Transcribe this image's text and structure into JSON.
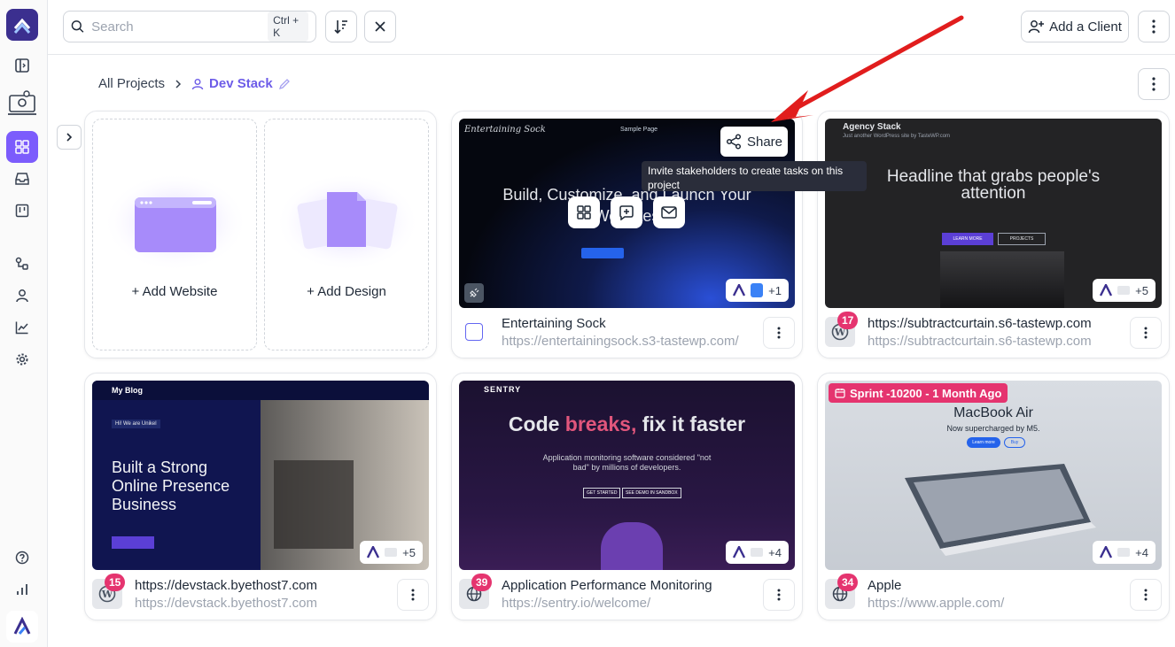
{
  "search": {
    "placeholder": "Search",
    "shortcut": "Ctrl + K"
  },
  "header": {
    "add_client_label": "Add a Client"
  },
  "breadcrumb": {
    "root": "All Projects",
    "current": "Dev Stack"
  },
  "add_tiles": {
    "website": "Add Website",
    "design": "Add Design"
  },
  "share": {
    "label": "Share",
    "tooltip": "Invite stakeholders to create tasks on this project"
  },
  "projects": [
    {
      "title": "Entertaining Sock",
      "url": "https://entertainingsock.s3-tastewp.com/",
      "extra": "+1",
      "thumb_text": "Build, Customize, and Launch Your Websites",
      "brand": "Entertaining Sock",
      "nav": "Sample Page"
    },
    {
      "title": "https://subtractcurtain.s6-tastewp.com",
      "url": "https://subtractcurtain.s6-tastewp.com",
      "badge": "17",
      "extra": "+5",
      "thumb_text": "Headline that grabs people's attention",
      "brand": "Agency Stack",
      "brand_sub": "Just another WordPress site by TasteWP.com",
      "cta1": "LEARN MORE",
      "cta2": "PROJECTS"
    },
    {
      "title": "https://devstack.byethost7.com",
      "url": "https://devstack.byethost7.com",
      "badge": "15",
      "extra": "+5",
      "thumb_text": "Built a Strong Online Presence Business",
      "brand": "My Blog",
      "hero_tag": "Hi! We are Unikel"
    },
    {
      "title": "Application Performance Monitoring",
      "url": "https://sentry.io/welcome/",
      "badge": "39",
      "extra": "+4",
      "thumb_text_1": "Code ",
      "thumb_text_2": "breaks,",
      "thumb_text_3": " fix it faster",
      "sub": "Application monitoring software considered \"not bad\" by millions of developers.",
      "brand": "SENTRY",
      "cta1": "GET STARTED",
      "cta2": "SEE DEMO IN SANDBOX"
    },
    {
      "title": "Apple",
      "url": "https://www.apple.com/",
      "badge": "34",
      "extra": "+4",
      "sprint": "Sprint -10200 - 1 Month Ago",
      "thumb_text": "MacBook Air",
      "sub": "Now supercharged by M5.",
      "cta1": "Learn more",
      "cta2": "Buy"
    }
  ]
}
